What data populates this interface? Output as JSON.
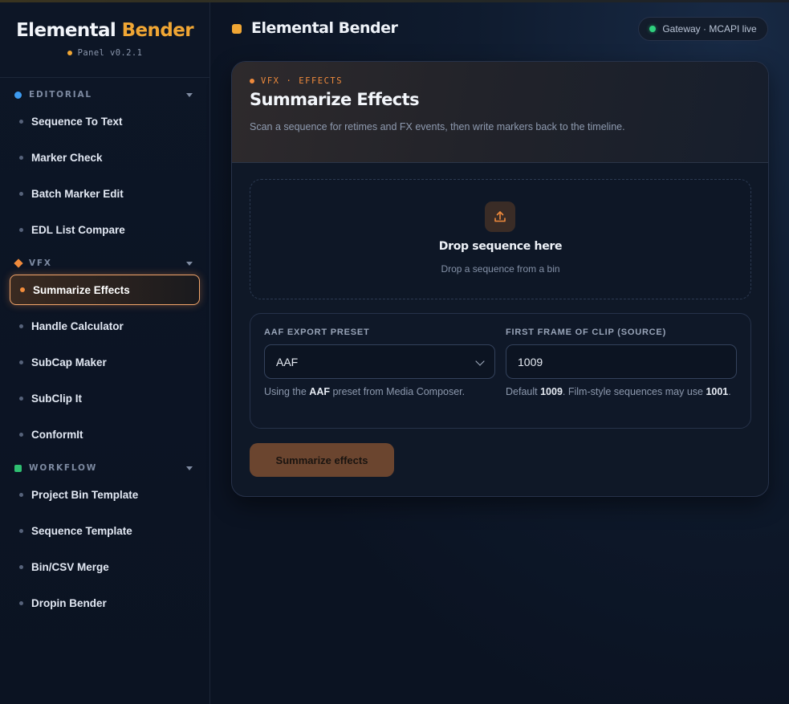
{
  "brand": {
    "title_main": "Elemental",
    "title_accent": "Bender",
    "version": "Panel v0.2.1"
  },
  "sidebar": {
    "sections": [
      {
        "label": "EDITORIAL",
        "items": [
          "Sequence To Text",
          "Marker Check",
          "Batch Marker Edit",
          "EDL List Compare"
        ]
      },
      {
        "label": "VFX",
        "items": [
          "Summarize Effects",
          "Handle Calculator",
          "SubCap Maker",
          "SubClip It",
          "ConformIt"
        ]
      },
      {
        "label": "WORKFLOW",
        "items": [
          "Project Bin Template",
          "Sequence Template",
          "Bin/CSV Merge",
          "Dropin Bender"
        ]
      }
    ],
    "active_item": "Summarize Effects"
  },
  "header": {
    "title": "Elemental Bender",
    "status": "Gateway · MCAPI live"
  },
  "card": {
    "crumb_section": "VFX",
    "crumb_sep": "·",
    "crumb_page": "EFFECTS",
    "title": "Summarize Effects",
    "description": "Scan a sequence for retimes and FX events, then write markers back to the timeline.",
    "drop": {
      "title": "Drop sequence here",
      "subtitle": "Drop a sequence from a bin"
    },
    "preset": {
      "label": "AAF EXPORT PRESET",
      "value": "AAF",
      "help_prefix": "Using the",
      "help_bold": "AAF",
      "help_suffix": "preset from Media Composer."
    },
    "first_frame": {
      "label": "FIRST FRAME OF CLIP (SOURCE)",
      "value": "1009",
      "help_prefix": "Default",
      "help_bold1": "1009",
      "help_mid": ". Film-style sequences may use",
      "help_bold2": "1001",
      "help_suffix": "."
    },
    "run_button": "Summarize effects"
  },
  "colors": {
    "accent_orange": "#ef8a3c",
    "brand_yellow": "#f0a634",
    "live_green": "#2fd07e",
    "editorial_blue": "#3d9bf0",
    "workflow_green": "#2fbf71"
  }
}
